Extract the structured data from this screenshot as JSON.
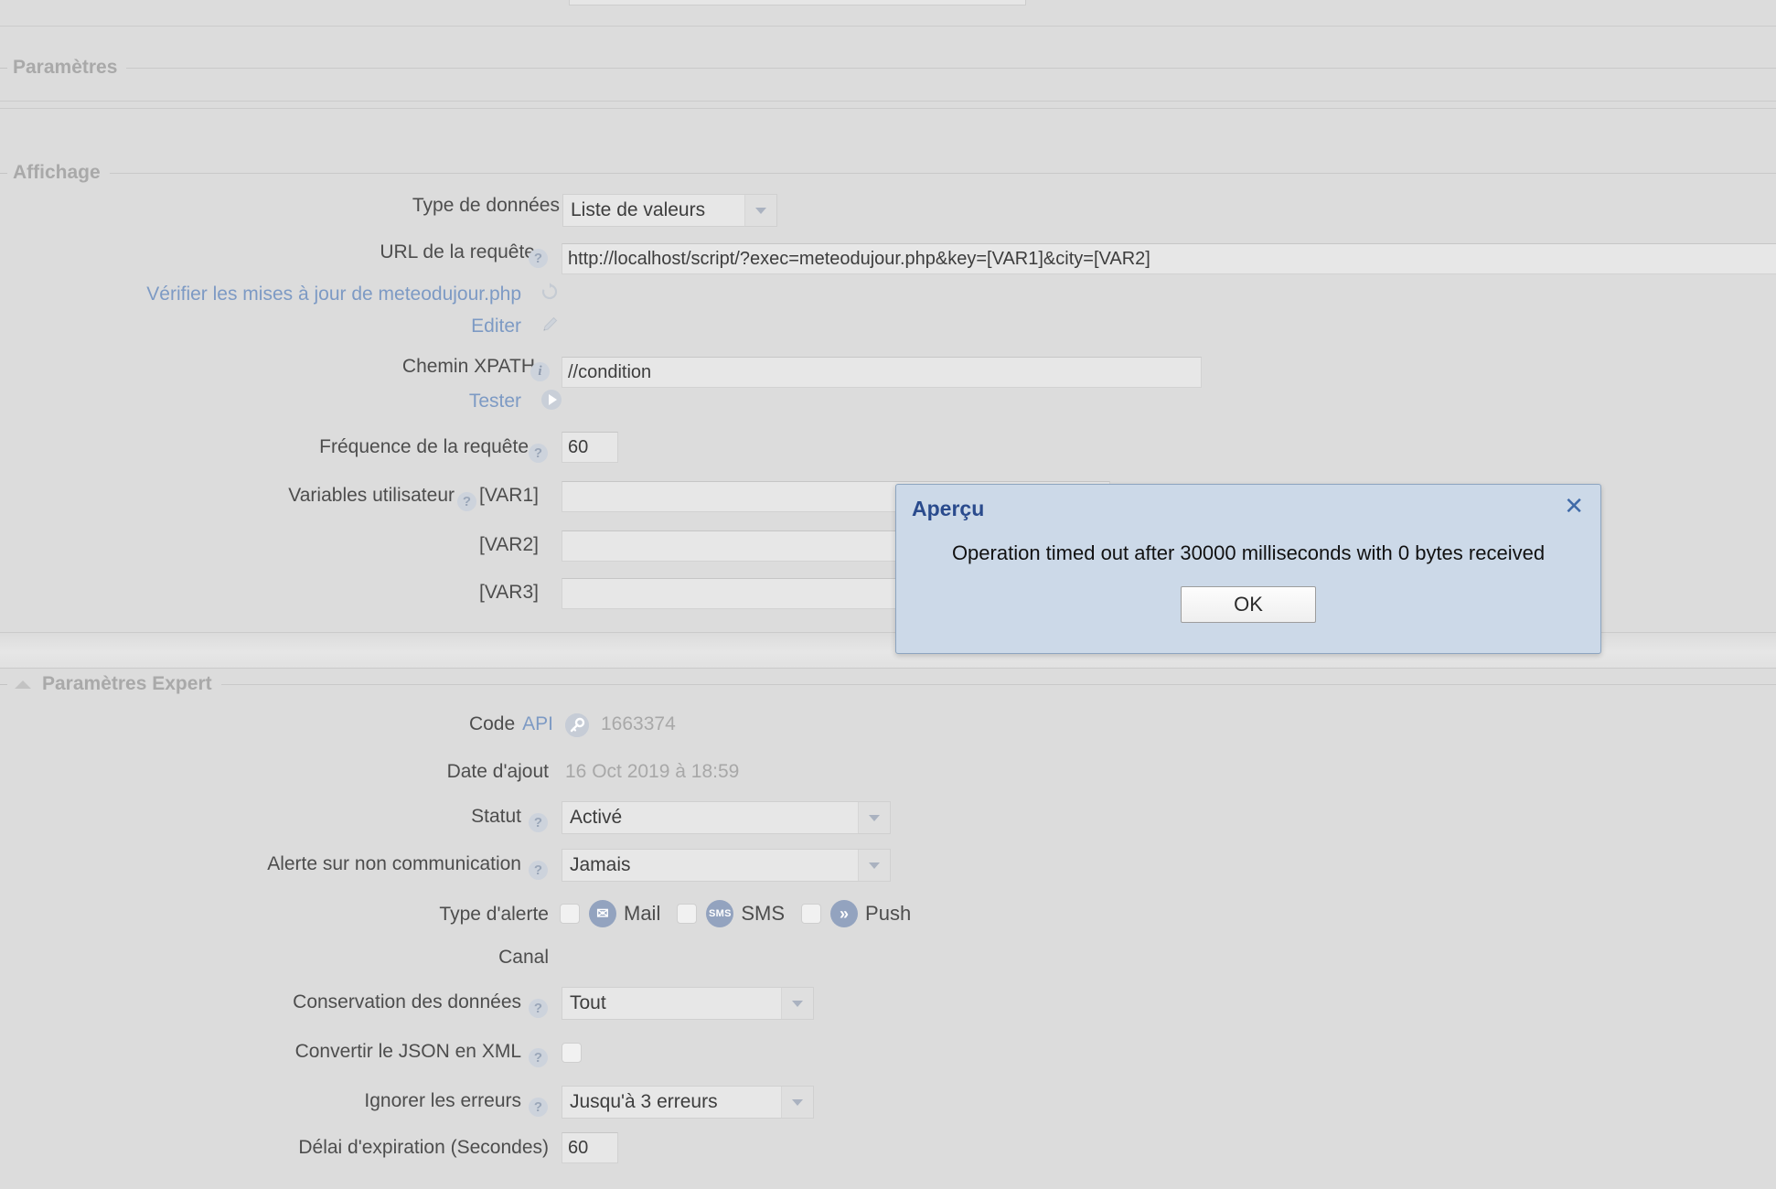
{
  "sections": {
    "parametres": "Paramètres",
    "affichage": "Affichage",
    "parametres_expert": "Paramètres Expert"
  },
  "affichage": {
    "type_de_donnees": {
      "label": "Type de données",
      "value": "Liste de valeurs"
    },
    "url_requete": {
      "label": "URL de la requête",
      "value": "http://localhost/script/?exec=meteodujour.php&key=[VAR1]&city=[VAR2]"
    },
    "verifier_maj_link": "Vérifier les mises à jour de meteodujour.php",
    "editer_link": "Editer",
    "chemin_xpath": {
      "label": "Chemin XPATH",
      "value": "//condition"
    },
    "tester_link": "Tester",
    "frequence": {
      "label": "Fréquence de la requête",
      "value": "60"
    },
    "variables": {
      "label": "Variables utilisateur",
      "rows": [
        {
          "name": "[VAR1]",
          "value": ""
        },
        {
          "name": "[VAR2]",
          "value": ""
        },
        {
          "name": "[VAR3]",
          "value": ""
        }
      ]
    }
  },
  "expert": {
    "code_api": {
      "label": "Code",
      "link": "API",
      "value": "1663374"
    },
    "date_ajout": {
      "label": "Date d'ajout",
      "value": "16 Oct 2019 à 18:59"
    },
    "statut": {
      "label": "Statut",
      "value": "Activé"
    },
    "alerte_non_communication": {
      "label": "Alerte sur non communication",
      "value": "Jamais"
    },
    "type_alerte": {
      "label": "Type d'alerte",
      "options": [
        {
          "label": "Mail",
          "icon": "mail-icon",
          "glyph": "✉",
          "checked": false
        },
        {
          "label": "SMS",
          "icon": "sms-icon",
          "glyph": "SMS",
          "checked": false
        },
        {
          "label": "Push",
          "icon": "push-icon",
          "glyph": "»",
          "checked": false
        }
      ]
    },
    "canal": {
      "label": "Canal"
    },
    "conservation": {
      "label": "Conservation des données",
      "value": "Tout"
    },
    "convertir_json": {
      "label": "Convertir le JSON en XML",
      "checked": false
    },
    "ignorer_erreurs": {
      "label": "Ignorer les erreurs",
      "value": "Jusqu'à 3 erreurs"
    },
    "delai_expiration": {
      "label": "Délai d'expiration (Secondes)",
      "value": "60"
    }
  },
  "dialog": {
    "title": "Aperçu",
    "message": "Operation timed out after 30000 milliseconds with 0 bytes received",
    "ok_label": "OK",
    "close_glyph": "✕"
  },
  "icons": {
    "help": "?",
    "info": "i",
    "refresh": "⟳",
    "play": "play-icon",
    "pencil": "pencil-icon",
    "key": "key-icon"
  },
  "colors": {
    "page_bg": "#dcdcdc",
    "link": "#7d9ac4",
    "dialog_bg": "#ccd9e8",
    "dialog_title": "#2a4b8d",
    "badge": "#93a3bf"
  }
}
